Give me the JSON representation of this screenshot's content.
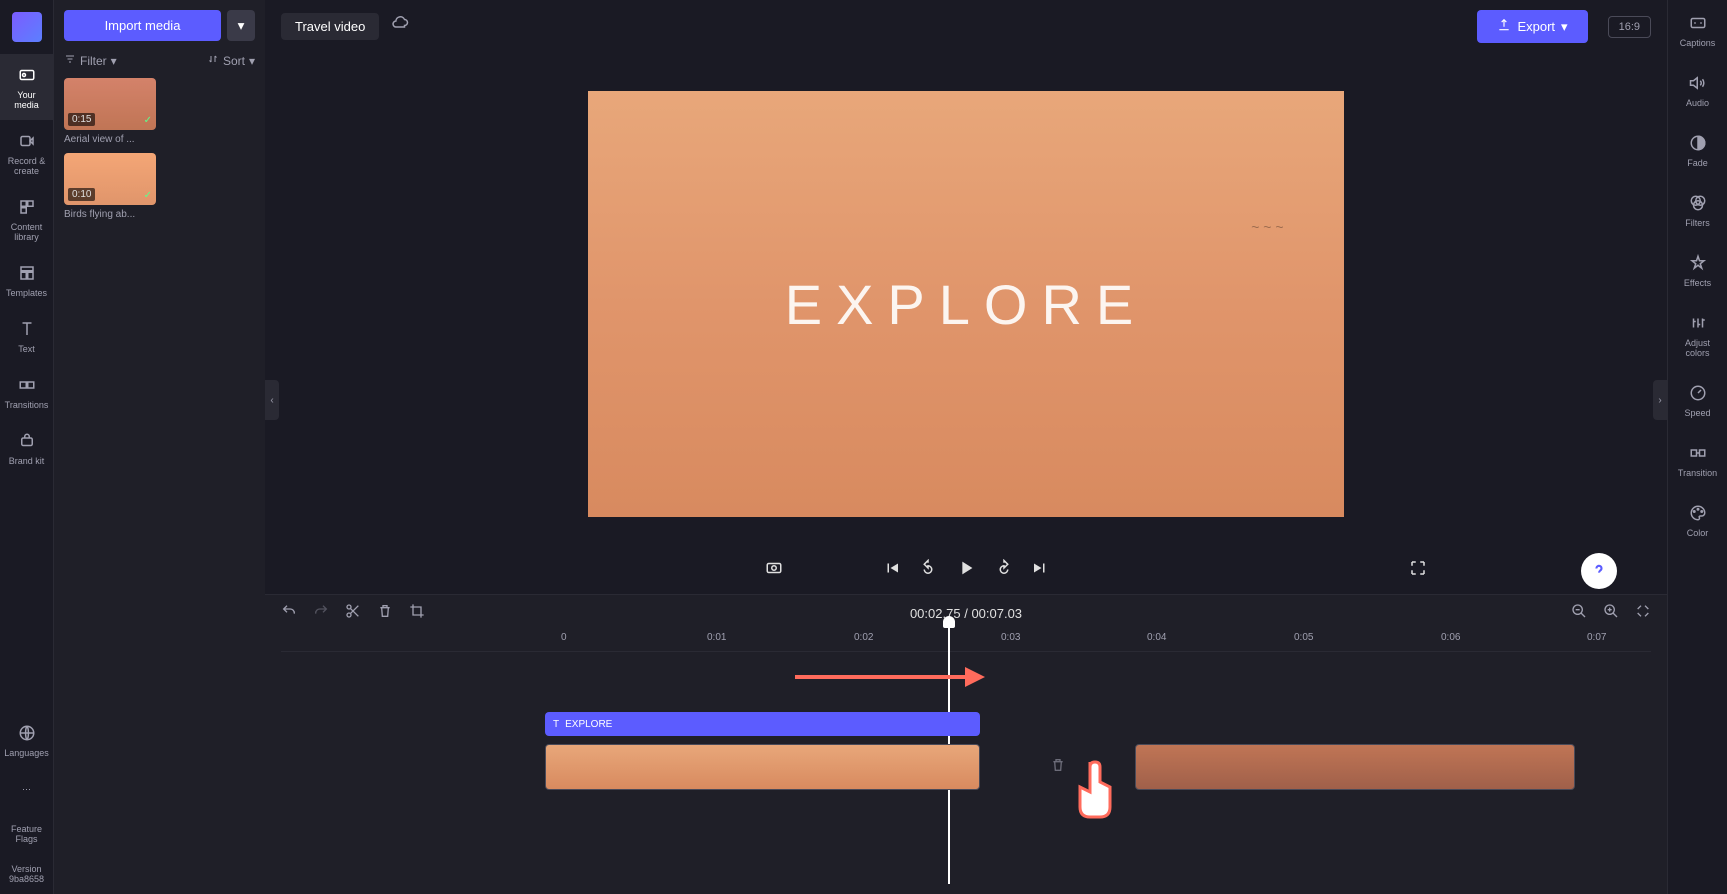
{
  "left_sidebar": {
    "items": [
      {
        "label": "Your media",
        "icon": "media"
      },
      {
        "label": "Record & create",
        "icon": "record"
      },
      {
        "label": "Content library",
        "icon": "library"
      },
      {
        "label": "Templates",
        "icon": "templates"
      },
      {
        "label": "Text",
        "icon": "text"
      },
      {
        "label": "Transitions",
        "icon": "transitions"
      },
      {
        "label": "Brand kit",
        "icon": "brand"
      }
    ],
    "bottom_items": [
      {
        "label": "Languages",
        "icon": "globe"
      },
      {
        "label": "",
        "icon": "more"
      },
      {
        "label": "Feature Flags",
        "icon": "flags"
      },
      {
        "label": "Version 9ba8658",
        "icon": "version"
      }
    ]
  },
  "media_panel": {
    "import_label": "Import media",
    "filter_label": "Filter",
    "sort_label": "Sort",
    "clips": [
      {
        "duration": "0:15",
        "name": "Aerial view of ..."
      },
      {
        "duration": "0:10",
        "name": "Birds flying ab..."
      }
    ]
  },
  "top_bar": {
    "project_title": "Travel video",
    "export_label": "Export",
    "aspect_ratio": "16:9"
  },
  "preview": {
    "overlay_text": "EXPLORE"
  },
  "time_display": {
    "current": "00:02.75",
    "separator": "/",
    "total": "00:07.03"
  },
  "timeline": {
    "ticks": [
      "0",
      "0:01",
      "0:02",
      "0:03",
      "0:04",
      "0:05",
      "0:06",
      "0:07"
    ],
    "text_clip_label": "EXPLORE"
  },
  "right_sidebar": {
    "items": [
      {
        "label": "Captions",
        "icon": "captions"
      },
      {
        "label": "Audio",
        "icon": "audio"
      },
      {
        "label": "Fade",
        "icon": "fade"
      },
      {
        "label": "Filters",
        "icon": "filters"
      },
      {
        "label": "Effects",
        "icon": "effects"
      },
      {
        "label": "Adjust colors",
        "icon": "adjust"
      },
      {
        "label": "Speed",
        "icon": "speed"
      },
      {
        "label": "Transition",
        "icon": "transition"
      },
      {
        "label": "Color",
        "icon": "color"
      }
    ]
  }
}
